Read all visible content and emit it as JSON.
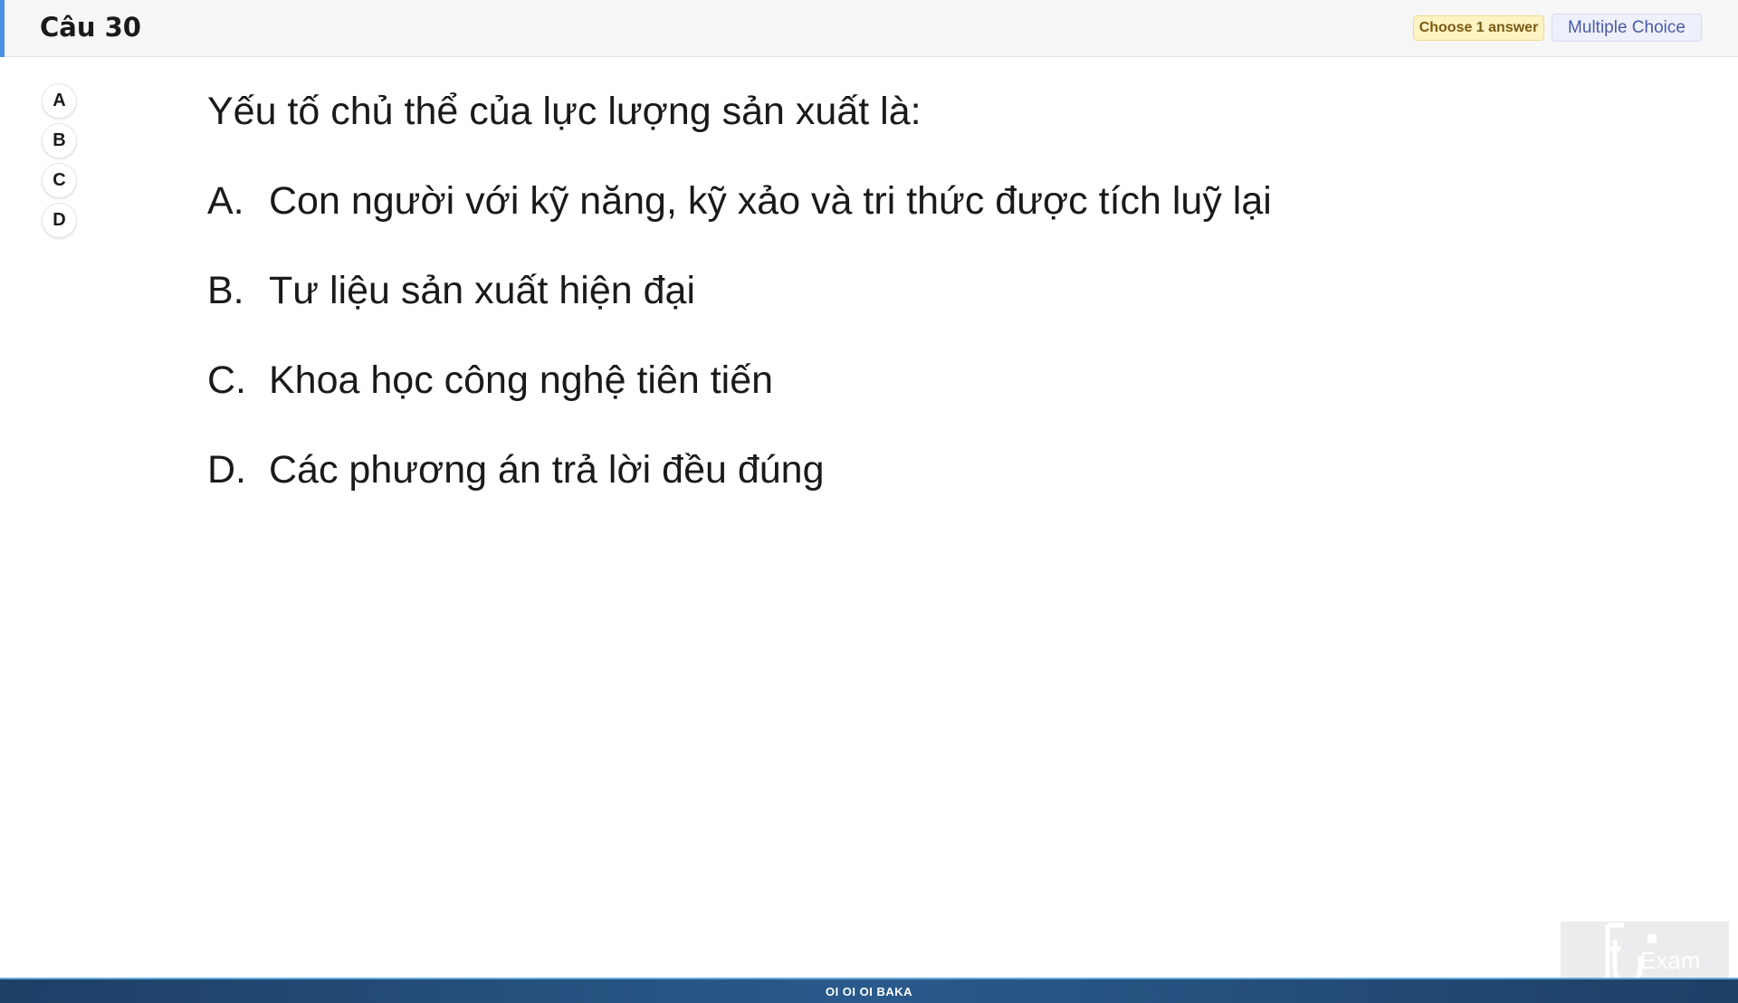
{
  "header": {
    "question_title": "Câu 30",
    "badge_choose": "Choose 1 answer",
    "badge_type": "Multiple Choice"
  },
  "answer_selector": {
    "options": [
      "A",
      "B",
      "C",
      "D"
    ]
  },
  "question": {
    "text": "Yếu tố chủ thể của lực lượng sản xuất là:",
    "choices": [
      {
        "letter": "A.",
        "text": "Con người với kỹ năng, kỹ xảo và tri thức được tích luỹ lại"
      },
      {
        "letter": "B.",
        "text": "Tư liệu sản xuất hiện đại"
      },
      {
        "letter": "C.",
        "text": "Khoa học công nghệ tiên tiến"
      },
      {
        "letter": "D.",
        "text": "Các phương án trả lời đều đúng"
      }
    ]
  },
  "watermark": {
    "text": "Exam",
    "icon": "fu-exam-logo"
  },
  "footer": {
    "text": "OI OI OI BAKA"
  },
  "colors": {
    "accent": "#4a90e2",
    "footer_bg": "#1e3f66"
  }
}
